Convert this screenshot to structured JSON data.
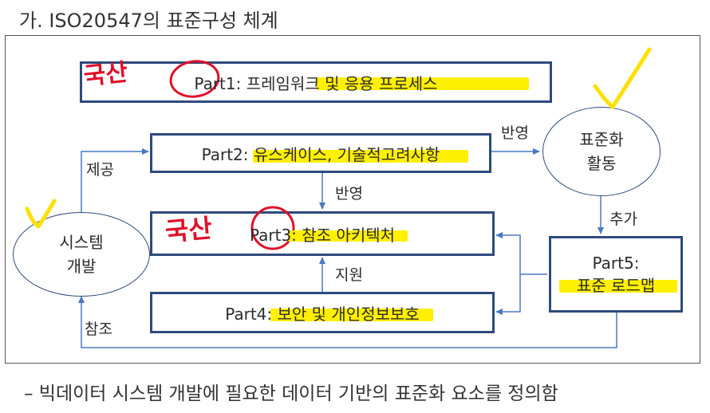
{
  "heading": "가.   ISO20547의 표준구성 체계",
  "boxes": {
    "part1": "Part1: 프레임워크 및 응용 프로세스",
    "part2": "Part2: 유스케이스, 기술적고려사항",
    "part3": "Part3: 참조 아키텍처",
    "part4": "Part4: 보안 및 개인정보보호",
    "part5_line1": "Part5:",
    "part5_line2": "표준 로드맵"
  },
  "ovals": {
    "standardization_line1": "표준화",
    "standardization_line2": "활동",
    "system_dev_line1": "시스템",
    "system_dev_line2": "개발"
  },
  "edge_labels": {
    "provide": "제공",
    "reflect_top": "반영",
    "reflect_mid": "반영",
    "add": "추가",
    "support": "지원",
    "reference": "참조"
  },
  "annotations": {
    "handwritten_1": "국산",
    "handwritten_2": "국산"
  },
  "colors": {
    "border": "#2e4a7d",
    "highlight": "#ffef00",
    "ink_red": "#e0102a"
  },
  "footer": "– 빅데이터 시스템 개발에 필요한 데이터 기반의 표준화 요소를 정의함"
}
